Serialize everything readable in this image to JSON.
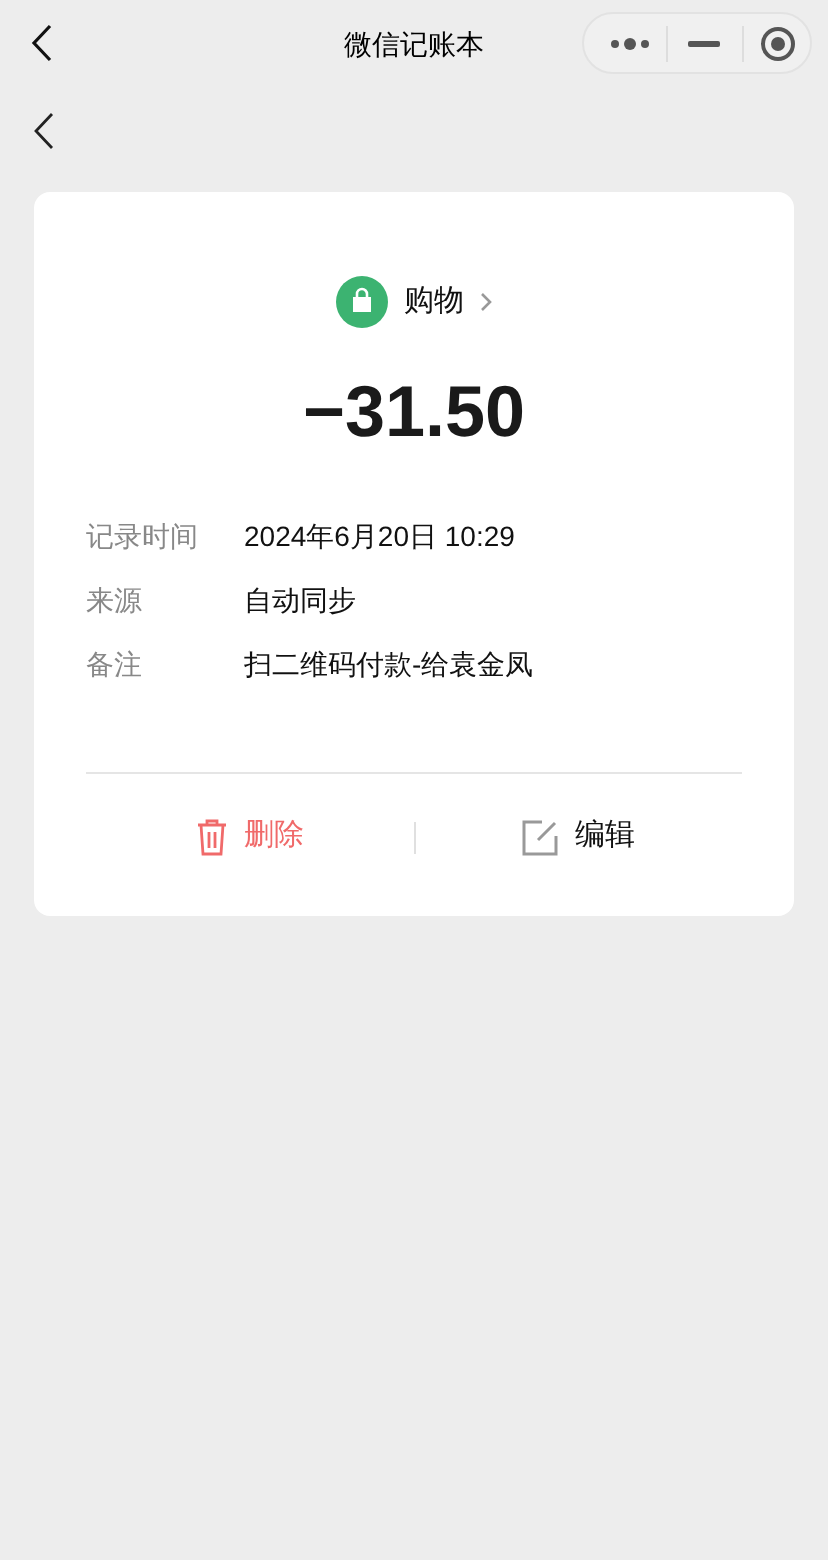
{
  "nav_bar": {
    "title": "微信记账本"
  },
  "category": {
    "kind": "bag",
    "label": "购物"
  },
  "amount": "−31.50",
  "details": [
    {
      "label": "记录时间",
      "value": "2024年6月20日 10:29"
    },
    {
      "label": "来源",
      "value": "自动同步"
    },
    {
      "label": "备注",
      "value": "扫二维码付款-给袁金凤"
    }
  ],
  "actions": [
    {
      "kind": "delete",
      "label": "删除"
    },
    {
      "kind": "edit",
      "label": "编辑"
    }
  ]
}
